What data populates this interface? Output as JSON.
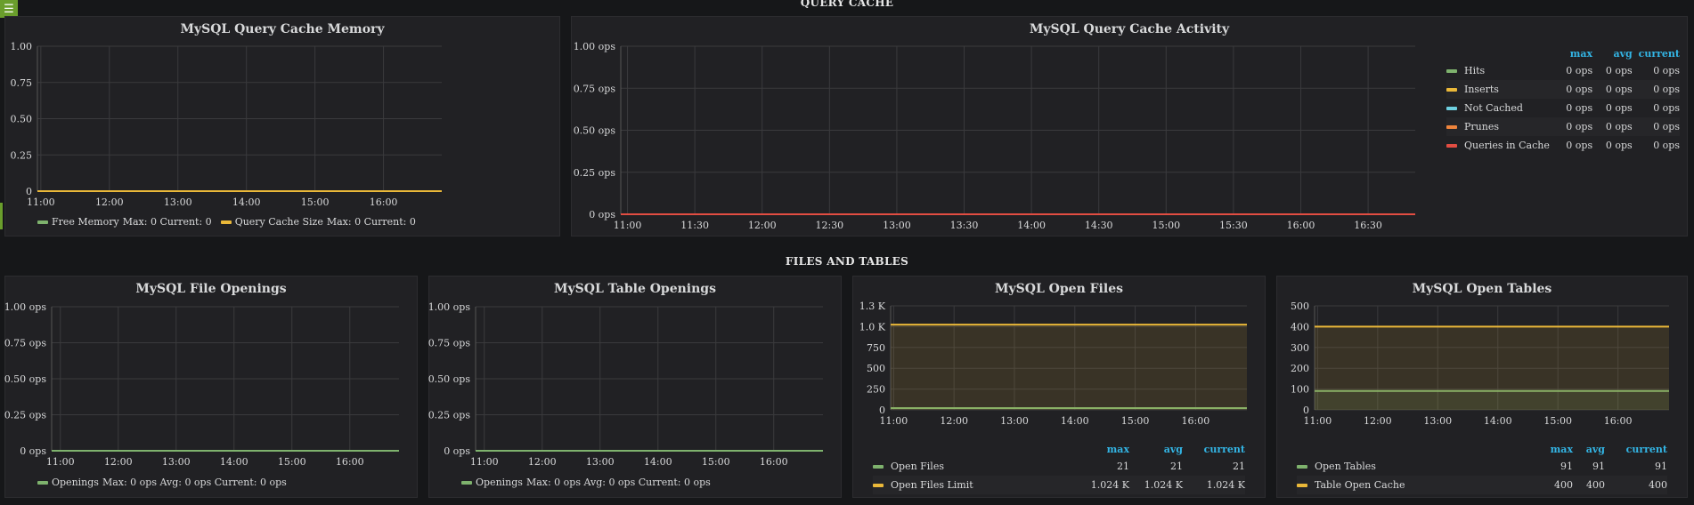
{
  "menu_icon": "hamburger-icon",
  "rows": [
    {
      "title": "QUERY CACHE"
    },
    {
      "title": "FILES AND TABLES"
    }
  ],
  "colors": {
    "green": "#7eb26d",
    "yellow": "#eab839",
    "cyan": "#6ed0e0",
    "orange": "#ef843c",
    "red": "#e24d42",
    "blue": "#33b5e5"
  },
  "panels": {
    "qc_memory": {
      "title": "MySQL Query Cache Memory",
      "legend": [
        {
          "name": "Free Memory",
          "stats": "Max: 0  Current: 0",
          "color": "#7eb26d"
        },
        {
          "name": "Query Cache Size",
          "stats": "Max: 0  Current: 0",
          "color": "#eab839"
        }
      ]
    },
    "qc_activity": {
      "title": "MySQL Query Cache Activity",
      "legend_headers": [
        "max",
        "avg",
        "current"
      ],
      "legend": [
        {
          "name": "Hits",
          "max": "0 ops",
          "avg": "0 ops",
          "current": "0 ops",
          "color": "#7eb26d"
        },
        {
          "name": "Inserts",
          "max": "0 ops",
          "avg": "0 ops",
          "current": "0 ops",
          "color": "#eab839"
        },
        {
          "name": "Not Cached",
          "max": "0 ops",
          "avg": "0 ops",
          "current": "0 ops",
          "color": "#6ed0e0"
        },
        {
          "name": "Prunes",
          "max": "0 ops",
          "avg": "0 ops",
          "current": "0 ops",
          "color": "#ef843c"
        },
        {
          "name": "Queries in Cache",
          "max": "0 ops",
          "avg": "0 ops",
          "current": "0 ops",
          "color": "#e24d42"
        }
      ]
    },
    "file_openings": {
      "title": "MySQL File Openings",
      "legend": [
        {
          "name": "Openings",
          "stats": "Max: 0 ops  Avg: 0 ops  Current: 0 ops",
          "color": "#7eb26d"
        }
      ]
    },
    "table_openings": {
      "title": "MySQL Table Openings",
      "legend": [
        {
          "name": "Openings",
          "stats": "Max: 0 ops  Avg: 0 ops  Current: 0 ops",
          "color": "#7eb26d"
        }
      ]
    },
    "open_files": {
      "title": "MySQL Open Files",
      "legend_headers": [
        "max",
        "avg",
        "current"
      ],
      "legend": [
        {
          "name": "Open Files",
          "max": "21",
          "avg": "21",
          "current": "21",
          "color": "#7eb26d"
        },
        {
          "name": "Open Files Limit",
          "max": "1.024 K",
          "avg": "1.024 K",
          "current": "1.024 K",
          "color": "#eab839"
        }
      ]
    },
    "open_tables": {
      "title": "MySQL Open Tables",
      "legend_headers": [
        "max",
        "avg",
        "current"
      ],
      "legend": [
        {
          "name": "Open Tables",
          "max": "91",
          "avg": "91",
          "current": "91",
          "color": "#7eb26d"
        },
        {
          "name": "Table Open Cache",
          "max": "400",
          "avg": "400",
          "current": "400",
          "color": "#eab839"
        }
      ]
    }
  },
  "chart_data": [
    {
      "type": "line",
      "title": "MySQL Query Cache Memory",
      "yticks": [
        "1.00",
        "0.75",
        "0.50",
        "0.25",
        "0"
      ],
      "ylim": [
        0,
        1
      ],
      "xticks": [
        "11:00",
        "12:00",
        "13:00",
        "14:00",
        "15:00",
        "16:00"
      ],
      "xlim": [
        10.95,
        16.85
      ],
      "series": [
        {
          "name": "Free Memory",
          "color": "#7eb26d",
          "x": [
            10.95,
            16.85
          ],
          "y": [
            0,
            0
          ]
        },
        {
          "name": "Query Cache Size",
          "color": "#eab839",
          "x": [
            10.95,
            16.85
          ],
          "y": [
            0,
            0
          ]
        }
      ]
    },
    {
      "type": "line",
      "title": "MySQL Query Cache Activity",
      "yticks": [
        "1.00 ops",
        "0.75 ops",
        "0.50 ops",
        "0.25 ops",
        "0 ops"
      ],
      "ylim": [
        0,
        1
      ],
      "xticks": [
        "11:00",
        "11:30",
        "12:00",
        "12:30",
        "13:00",
        "13:30",
        "14:00",
        "14:30",
        "15:00",
        "15:30",
        "16:00",
        "16:30"
      ],
      "xlim": [
        10.95,
        16.85
      ],
      "series": [
        {
          "name": "Hits",
          "color": "#7eb26d",
          "x": [
            10.95,
            16.85
          ],
          "y": [
            0,
            0
          ]
        },
        {
          "name": "Inserts",
          "color": "#eab839",
          "x": [
            10.95,
            16.85
          ],
          "y": [
            0,
            0
          ]
        },
        {
          "name": "Not Cached",
          "color": "#6ed0e0",
          "x": [
            10.95,
            16.85
          ],
          "y": [
            0,
            0
          ]
        },
        {
          "name": "Prunes",
          "color": "#ef843c",
          "x": [
            10.95,
            16.85
          ],
          "y": [
            0,
            0
          ]
        },
        {
          "name": "Queries in Cache",
          "color": "#e24d42",
          "x": [
            10.95,
            16.85
          ],
          "y": [
            0,
            0
          ]
        }
      ]
    },
    {
      "type": "line",
      "title": "MySQL File Openings",
      "yticks": [
        "1.00 ops",
        "0.75 ops",
        "0.50 ops",
        "0.25 ops",
        "0 ops"
      ],
      "ylim": [
        0,
        1
      ],
      "xticks": [
        "11:00",
        "12:00",
        "13:00",
        "14:00",
        "15:00",
        "16:00"
      ],
      "xlim": [
        10.85,
        16.85
      ],
      "series": [
        {
          "name": "Openings",
          "color": "#7eb26d",
          "x": [
            10.85,
            16.85
          ],
          "y": [
            0,
            0
          ]
        }
      ]
    },
    {
      "type": "line",
      "title": "MySQL Table Openings",
      "yticks": [
        "1.00 ops",
        "0.75 ops",
        "0.50 ops",
        "0.25 ops",
        "0 ops"
      ],
      "ylim": [
        0,
        1
      ],
      "xticks": [
        "11:00",
        "12:00",
        "13:00",
        "14:00",
        "15:00",
        "16:00"
      ],
      "xlim": [
        10.85,
        16.85
      ],
      "series": [
        {
          "name": "Openings",
          "color": "#7eb26d",
          "x": [
            10.85,
            16.85
          ],
          "y": [
            0,
            0
          ]
        }
      ]
    },
    {
      "type": "area",
      "title": "MySQL Open Files",
      "yticks": [
        "1.3 K",
        "1.0 K",
        "750",
        "500",
        "250",
        "0"
      ],
      "ytick_values": [
        1250,
        1000,
        750,
        500,
        250,
        0
      ],
      "ylim": [
        0,
        1250
      ],
      "xticks": [
        "11:00",
        "12:00",
        "13:00",
        "14:00",
        "15:00",
        "16:00"
      ],
      "xlim": [
        10.95,
        16.85
      ],
      "series": [
        {
          "name": "Open Files",
          "color": "#7eb26d",
          "x": [
            10.95,
            16.85
          ],
          "y": [
            21,
            21
          ]
        },
        {
          "name": "Open Files Limit",
          "color": "#eab839",
          "x": [
            10.95,
            16.85
          ],
          "y": [
            1024,
            1024
          ]
        }
      ]
    },
    {
      "type": "area",
      "title": "MySQL Open Tables",
      "yticks": [
        "500",
        "400",
        "300",
        "200",
        "100",
        "0"
      ],
      "ytick_values": [
        500,
        400,
        300,
        200,
        100,
        0
      ],
      "ylim": [
        0,
        500
      ],
      "xticks": [
        "11:00",
        "12:00",
        "13:00",
        "14:00",
        "15:00",
        "16:00"
      ],
      "xlim": [
        10.95,
        16.85
      ],
      "series": [
        {
          "name": "Open Tables",
          "color": "#7eb26d",
          "x": [
            10.95,
            16.85
          ],
          "y": [
            91,
            91
          ]
        },
        {
          "name": "Table Open Cache",
          "color": "#eab839",
          "x": [
            10.95,
            16.85
          ],
          "y": [
            400,
            400
          ]
        }
      ]
    }
  ]
}
